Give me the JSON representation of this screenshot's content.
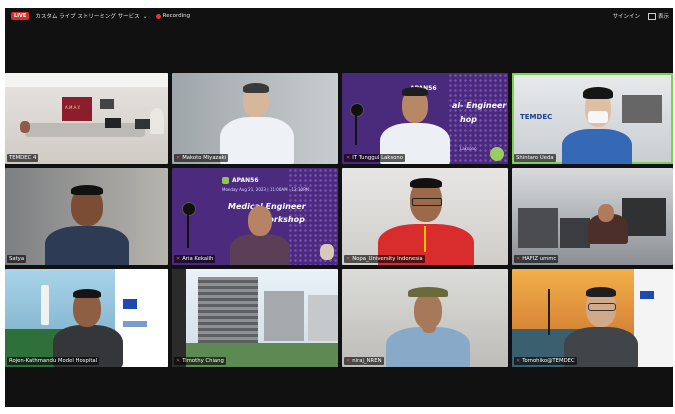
{
  "topbar": {
    "live_badge": "LIVE",
    "title": "カスタム ライブ ストリーミング サービス",
    "recording": "Recording",
    "signin": "サインイン",
    "view": "表示"
  },
  "participants": [
    {
      "name": "TEMDEC 4",
      "muted": false
    },
    {
      "name": "Makoto Miyazaki",
      "muted": true
    },
    {
      "name": "IT Tunggul Laksono",
      "muted": true
    },
    {
      "name": "Shintaro Ueda",
      "muted": false
    },
    {
      "name": "Satya",
      "muted": false
    },
    {
      "name": "Aria Kekalih",
      "muted": true
    },
    {
      "name": "Nopa_University Indonesia",
      "muted": true
    },
    {
      "name": "HAFIZ ummc",
      "muted": true
    },
    {
      "name": "Rojen-Kathmandu Model Hospital",
      "muted": true
    },
    {
      "name": "Timothy Chiang",
      "muted": true
    },
    {
      "name": "niraj_NREN",
      "muted": true
    },
    {
      "name": "Tomohiko@TEMDEC",
      "muted": true
    }
  ],
  "slides": {
    "apan": "APAN56",
    "date_text": "Monday Aug 21, 2023 | 11:00AM - 12:30PM",
    "title_line1": "Medical Engineer",
    "title_line2": "Workshop",
    "partial_title_a": "al- Engineer",
    "partial_title_b": "hop",
    "partial_presenter": "Laksono",
    "temdec_logo": "TEMDEC",
    "unima_logo": "A.M.A.Y."
  },
  "mute_icon": "muted-mic-icon"
}
